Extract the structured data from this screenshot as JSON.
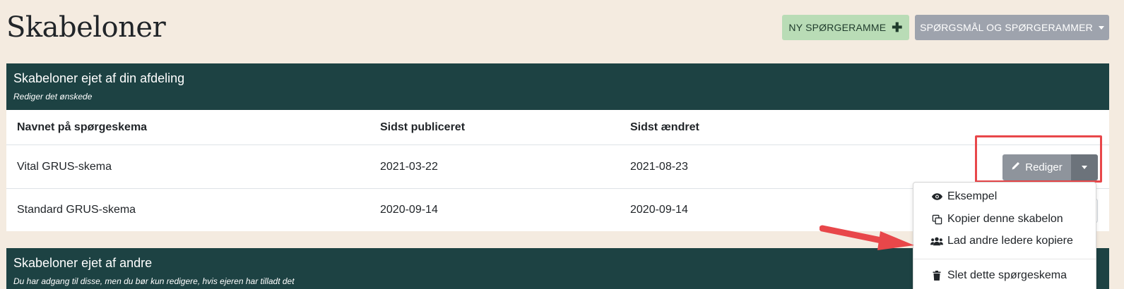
{
  "page": {
    "title": "Skabeloner"
  },
  "toolbar": {
    "new_label": "NY SPØRGERAMME",
    "new_icon": "plus-icon",
    "questions_label": "SPØRGSMÅL OG SPØRGERAMMER",
    "questions_icon": "caret-down-icon"
  },
  "own_section": {
    "title": "Skabeloner ejet af din afdeling",
    "subtitle": "Rediger det ønskede",
    "columns": [
      "Navnet på spørgeskema",
      "Sidst publiceret",
      "Sidst ændret"
    ],
    "rows": [
      {
        "name": "Vital GRUS-skema",
        "published": "2021-03-22",
        "changed": "2021-08-23"
      },
      {
        "name": "Standard GRUS-skema",
        "published": "2020-09-14",
        "changed": "2020-09-14"
      }
    ],
    "edit_label": "Rediger",
    "edit_icon": "pencil-icon"
  },
  "dropdown": {
    "items": [
      {
        "label": "Eksempel",
        "icon": "eye-icon"
      },
      {
        "label": "Kopier denne skabelon",
        "icon": "copy-icon"
      },
      {
        "label": "Lad andre ledere kopiere",
        "icon": "users-icon"
      },
      {
        "label": "Slet dette spørgeskema",
        "icon": "trash-icon"
      }
    ]
  },
  "others_section": {
    "title": "Skabeloner ejet af andre",
    "subtitle": "Du har adgang til disse, men du bør kun redigere, hvis ejeren har tilladt det"
  },
  "colors": {
    "background": "#f4ebe0",
    "card_header": "#1d4243",
    "new_button": "#b9dcb6",
    "secondary_button": "#9ea3ad",
    "annotation": "#e8474a"
  }
}
